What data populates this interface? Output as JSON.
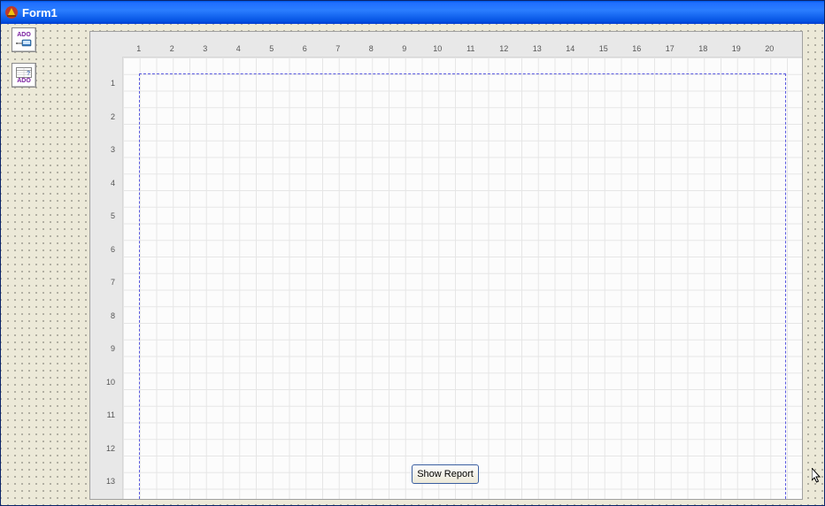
{
  "window": {
    "title": "Form1"
  },
  "components": {
    "adoconnection": {
      "label": "ADO"
    },
    "adoquery": {
      "label": "ADO"
    }
  },
  "preview": {
    "h_ruler": [
      "1",
      "2",
      "3",
      "4",
      "5",
      "6",
      "7",
      "8",
      "9",
      "10",
      "11",
      "12",
      "13",
      "14",
      "15",
      "16",
      "17",
      "18",
      "19",
      "20"
    ],
    "v_ruler": [
      "1",
      "2",
      "3",
      "4",
      "5",
      "6",
      "7",
      "8",
      "9",
      "10",
      "11",
      "12",
      "13"
    ]
  },
  "button": {
    "show_report": "Show Report"
  }
}
